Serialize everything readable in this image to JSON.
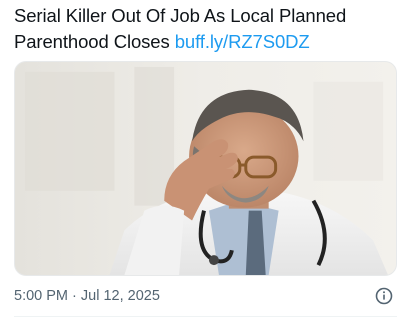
{
  "tweet": {
    "text": "Serial Killer Out Of Job As Local Planned Parenthood Closes ",
    "link_text": "buff.ly/RZ7S0DZ"
  },
  "media": {
    "icon": "photo-doctor-facepalm"
  },
  "meta": {
    "timestamp": "5:00 PM · Jul 12, 2025"
  },
  "icons": {
    "info": "info-circle-icon"
  },
  "colors": {
    "text": "#0f1419",
    "link": "#1d9bf0",
    "muted": "#536471"
  }
}
